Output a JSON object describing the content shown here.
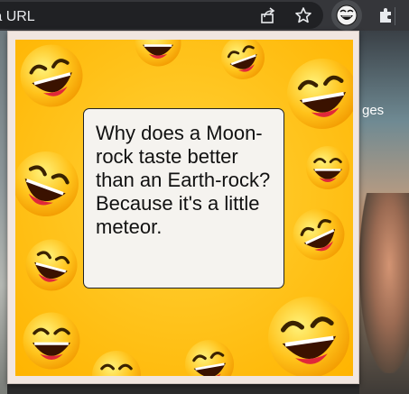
{
  "browser": {
    "omnibox_text": "e a URL",
    "icons": [
      "share-icon",
      "star-icon",
      "joke-extension-icon",
      "puzzle-icon"
    ]
  },
  "background_page": {
    "label": "ges"
  },
  "popup": {
    "joke": "Why does a Moon-rock taste better than an Earth-rock? Because it's a little meteor."
  },
  "colors": {
    "toolbar": "#35363a",
    "card_yellow": "#ffc21a",
    "joke_box": "#f5f3ef",
    "popup_frame": "#f1e6e0"
  }
}
